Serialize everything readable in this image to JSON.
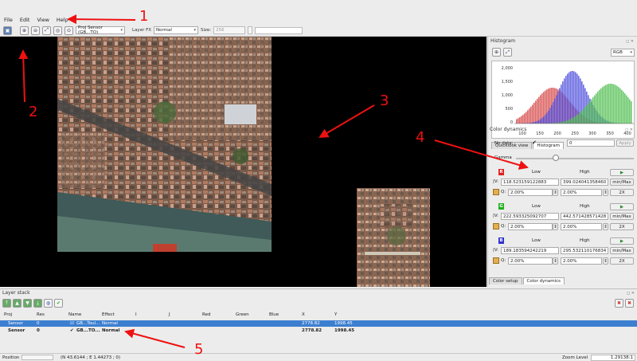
{
  "menu": [
    "File",
    "Edit",
    "View",
    "Help"
  ],
  "toolbar": {
    "proj_combo": "Proj Sensor (GB,..TO)",
    "layer_fx_label": "Layer FX",
    "layer_fx_value": "Normal",
    "size_label": "Size:",
    "size_value": "256"
  },
  "histogram": {
    "title": "Histogram",
    "mode": "RGB",
    "y_ticks": [
      "2,000",
      "1,500",
      "1,000",
      "500",
      "0"
    ],
    "x_ticks": [
      "100",
      "150",
      "200",
      "250",
      "300",
      "350",
      "400"
    ],
    "tabs": [
      "Quicklook view",
      "Histogram"
    ],
    "colors": {
      "red": "#d23030",
      "green": "#3ab53a",
      "blue": "#3a3ad8"
    }
  },
  "color_dynamics": {
    "title": "Color dynamics",
    "nodata_label": "No data:",
    "nodata_value": "0",
    "apply_label": "Apply",
    "gamma_label": "Gamma",
    "low_label": "Low",
    "high_label": "High",
    "minmax_label": "min/Max",
    "twox_label": "2X",
    "v_label": "|V:",
    "q_label": "Q:",
    "channels": [
      {
        "name": "R",
        "color": "#e02020",
        "low_v": "118.523159122883",
        "high_v": "399.024041358460",
        "low_q": "2.00%",
        "high_q": "2.00%"
      },
      {
        "name": "G",
        "color": "#20b020",
        "low_v": "222.593325092707",
        "high_v": "442.571428571428",
        "low_q": "2.00%",
        "high_q": "2.00%"
      },
      {
        "name": "B",
        "color": "#3030d0",
        "low_v": "189.183594242219",
        "high_v": "295.532110176834",
        "low_q": "2.00%",
        "high_q": "2.00%"
      }
    ],
    "bottom_tabs": [
      "Color setup",
      "Color dynamics"
    ]
  },
  "layer_stack": {
    "title": "Layer stack",
    "columns": [
      "Proj",
      "Res",
      "Name",
      "Effect",
      "I",
      "J",
      "Red",
      "Green",
      "Blue",
      "X",
      "Y"
    ],
    "rows": [
      {
        "proj": "Sensor",
        "res": "0",
        "name": "GB...Toul...",
        "effect": "Normal",
        "x": "2778.82",
        "y": "1998.45",
        "selected": true
      },
      {
        "proj": "Sensor",
        "res": "0",
        "name": "GB...TO...",
        "effect": "Normal",
        "x": "2778.82",
        "y": "1998.45",
        "selected": false
      }
    ]
  },
  "status": {
    "position_label": "Position",
    "position_value": "(N 43.6144 ; E 1.44273 ; 0)",
    "zoom_label": "Zoom Level",
    "zoom_value": "1.29138:1"
  },
  "annotations": [
    "1",
    "2",
    "3",
    "4",
    "5"
  ]
}
